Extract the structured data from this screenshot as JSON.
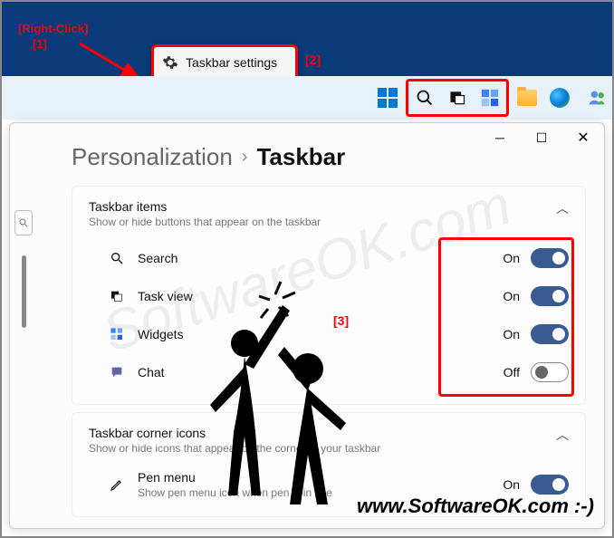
{
  "annotations": {
    "one_line1": "[Right-Click]",
    "one_line2": "[1]",
    "two": "[2]",
    "three": "[3]"
  },
  "context_menu": {
    "label": "Taskbar settings"
  },
  "breadcrumb": {
    "parent": "Personalization",
    "current": "Taskbar"
  },
  "section1": {
    "title": "Taskbar items",
    "subtitle": "Show or hide buttons that appear on the taskbar",
    "items": [
      {
        "label": "Search",
        "state_text": "On",
        "on": true
      },
      {
        "label": "Task view",
        "state_text": "On",
        "on": true
      },
      {
        "label": "Widgets",
        "state_text": "On",
        "on": true
      },
      {
        "label": "Chat",
        "state_text": "Off",
        "on": false
      }
    ]
  },
  "section2": {
    "title": "Taskbar corner icons",
    "subtitle": "Show or hide icons that appear on the corner of your taskbar",
    "item": {
      "label": "Pen menu",
      "sub": "Show pen menu icon when pen is in use",
      "state_text": "On",
      "on": true
    }
  },
  "watermarks": {
    "diag": "SoftwareOK.com",
    "footer": "www.SoftwareOK.com :-)"
  }
}
